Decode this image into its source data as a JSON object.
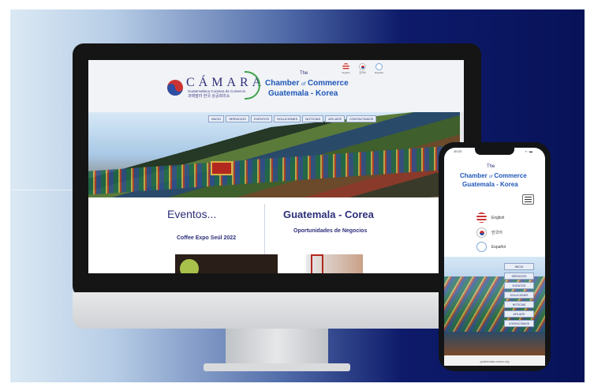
{
  "desktop": {
    "logo": {
      "name": "CÁMARA",
      "subtitle": "Guatemalteca Coreana de Comercio",
      "korean": "과테말라 한국 상공회의소"
    },
    "header": {
      "the": "The",
      "chamber": "Chamber",
      "of": "of",
      "commerce": "Commerce",
      "country": "Guatemala - Korea"
    },
    "languages": [
      {
        "label": "English",
        "icon": "us-flag-icon"
      },
      {
        "label": "한국어",
        "icon": "korea-flag-icon"
      },
      {
        "label": "Español",
        "icon": "guatemala-flag-icon"
      }
    ],
    "nav": [
      "INICIO",
      "SERVICIOS",
      "EVENTOS",
      "SOLUCIONES",
      "NOTICIAS",
      "AFILIATE",
      "CONTACTANOS"
    ],
    "events_heading": "Eventos...",
    "event_title": "Coffee Expo Seúl 2022",
    "main_heading": "Guatemala - Corea",
    "main_subheading": "Oportunidades de Negocios"
  },
  "phone": {
    "time": "10:23",
    "status": "▪ ◦ ▬",
    "the": "The",
    "chamber": "Chamber",
    "of": "of",
    "commerce": "Commerce",
    "country": "Guatemala - Korea",
    "languages": [
      {
        "label": "English",
        "icon": "us-flag-icon"
      },
      {
        "label": "한국어",
        "icon": "korea-flag-icon"
      },
      {
        "label": "Español",
        "icon": "guatemala-flag-icon"
      }
    ],
    "nav": [
      "INICIO",
      "SERVICIOS",
      "EVENTOS",
      "SOLUCIONES",
      "NOTICIAS",
      "AFILIATE",
      "CONTACTANOS"
    ],
    "url": "guatemala-corea.org"
  },
  "colors": {
    "accent": "#1f57b8",
    "brand": "#2d2f7a",
    "green": "#3fa34d"
  }
}
